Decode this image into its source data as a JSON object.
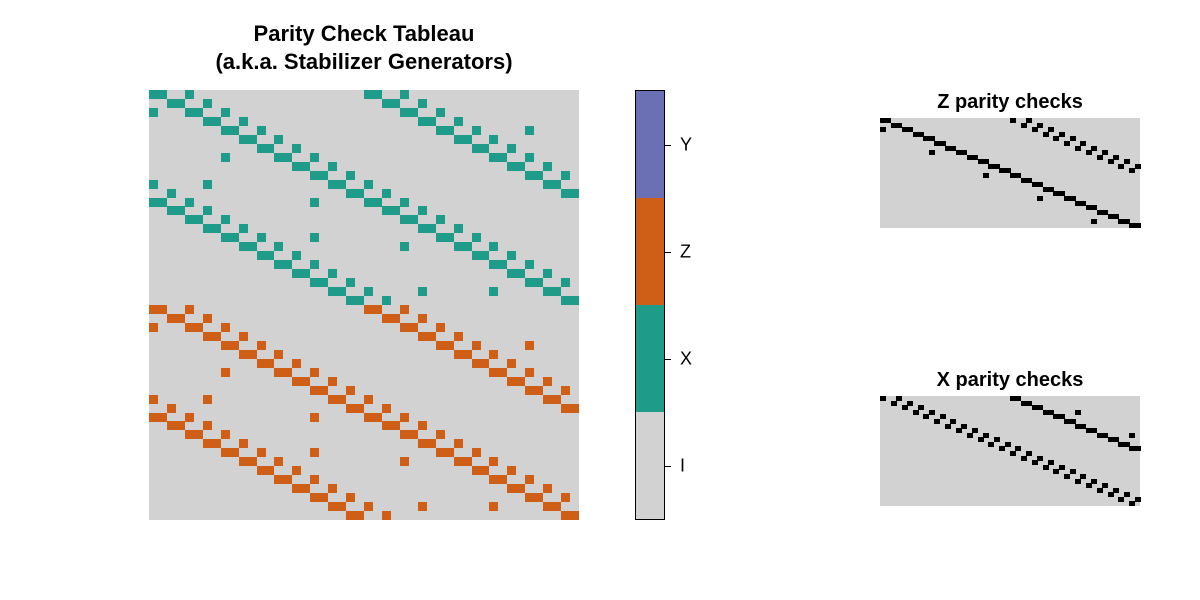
{
  "chart_data": {
    "type": "heatmap",
    "title_line1": "Parity Check Tableau",
    "title_line2": "(a.k.a. Stabilizer Generators)",
    "main": {
      "rows": 48,
      "cols": 48,
      "comment": "Stabilizer tableau for a CSS surface-like code. Upper half rows encode X stabilizers (entries 'X'), lower half encode Z stabilizers (entries 'Z'). Background cells are identity 'I'. Pattern: each stabilizer touches ~4 physical qubits forming diagonals with a doubled-diagonal band structure and a few sparse off-diagonal dots.",
      "palette": {
        "I": "#d2d2d2",
        "X": "#1e9c89",
        "Z": "#cf5f16",
        "Y": "#6b6fb4"
      }
    },
    "z_checks": {
      "title": "Z parity checks",
      "rows": 24,
      "cols": 48,
      "palette": {
        "0": "#d2d2d2",
        "1": "#000000"
      }
    },
    "x_checks": {
      "title": "X parity checks",
      "rows": 24,
      "cols": 48,
      "palette": {
        "0": "#d2d2d2",
        "1": "#000000"
      }
    },
    "legend_labels": [
      "Y",
      "Z",
      "X",
      "I"
    ],
    "legend_colors": [
      "#6b6fb4",
      "#cf5f16",
      "#1e9c89",
      "#d2d2d2"
    ]
  }
}
